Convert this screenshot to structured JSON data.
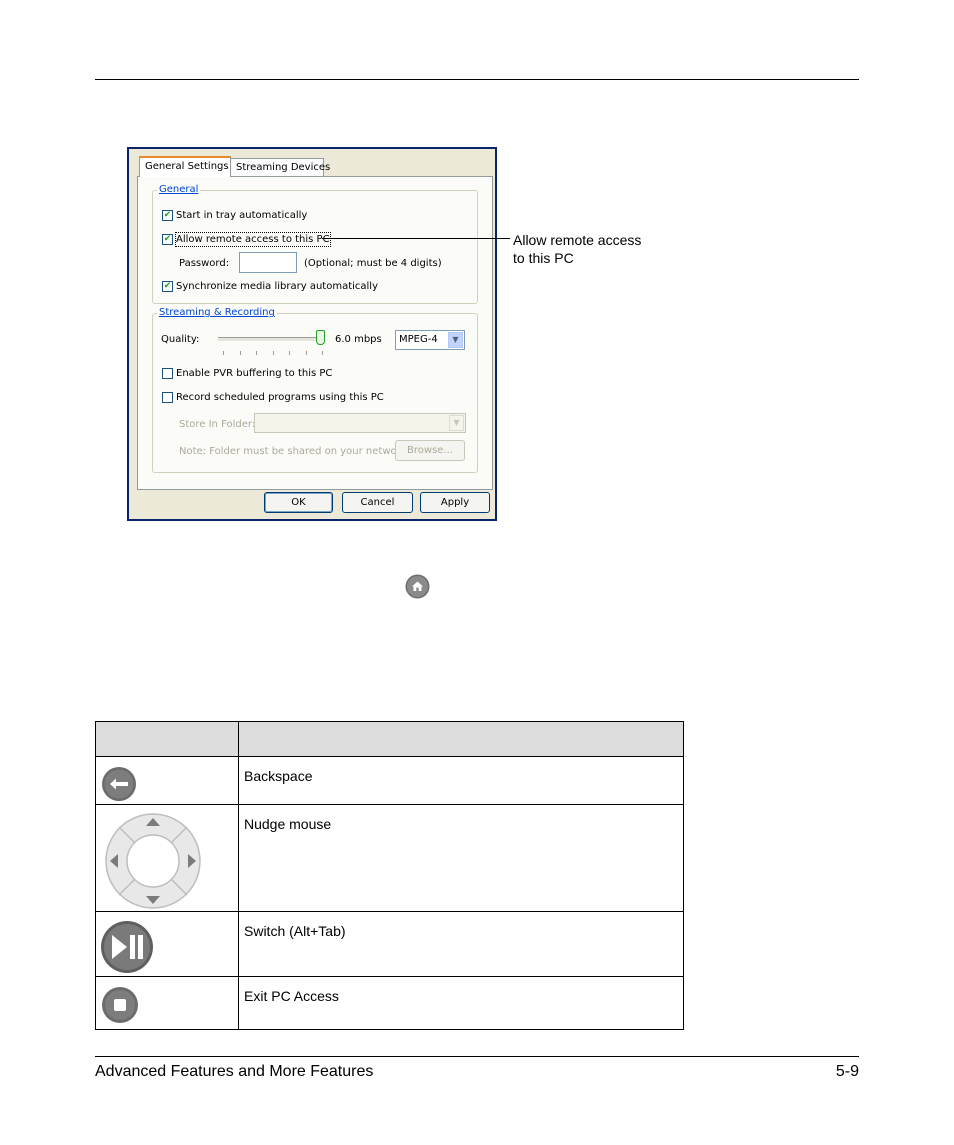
{
  "dialog": {
    "tabs": [
      "General Settings",
      "Streaming Devices"
    ],
    "general": {
      "title": "General",
      "start_in_tray": "Start in tray automatically",
      "allow_remote": "Allow remote access to this PC",
      "password_label": "Password:",
      "password_value": "",
      "password_hint": "(Optional; must be 4 digits)",
      "sync_media": "Synchronize media library automatically"
    },
    "streaming": {
      "title": "Streaming & Recording",
      "quality_label": "Quality:",
      "quality_value": "6.0 mbps",
      "quality_level": 1.0,
      "format": "MPEG-4",
      "enable_pvr": "Enable PVR buffering to this PC",
      "record_scheduled": "Record scheduled programs using this PC",
      "store_folder_label": "Store In Folder:",
      "note": "Note: Folder must be shared on your network",
      "browse": "Browse..."
    },
    "buttons": {
      "ok": "OK",
      "cancel": "Cancel",
      "apply": "Apply"
    }
  },
  "callout": {
    "line1": "Allow remote access",
    "line2": "to this PC"
  },
  "table": {
    "rows": [
      {
        "icon": "backspace-icon",
        "description": "Backspace"
      },
      {
        "icon": "nudge-mouse-dpad-icon",
        "description": "Nudge mouse"
      },
      {
        "icon": "play-pause-icon",
        "description": "Switch (Alt+Tab)"
      },
      {
        "icon": "stop-icon",
        "description": "Exit PC Access"
      }
    ]
  },
  "footer": {
    "title": "Advanced Features and More Features",
    "page": "5-9"
  }
}
